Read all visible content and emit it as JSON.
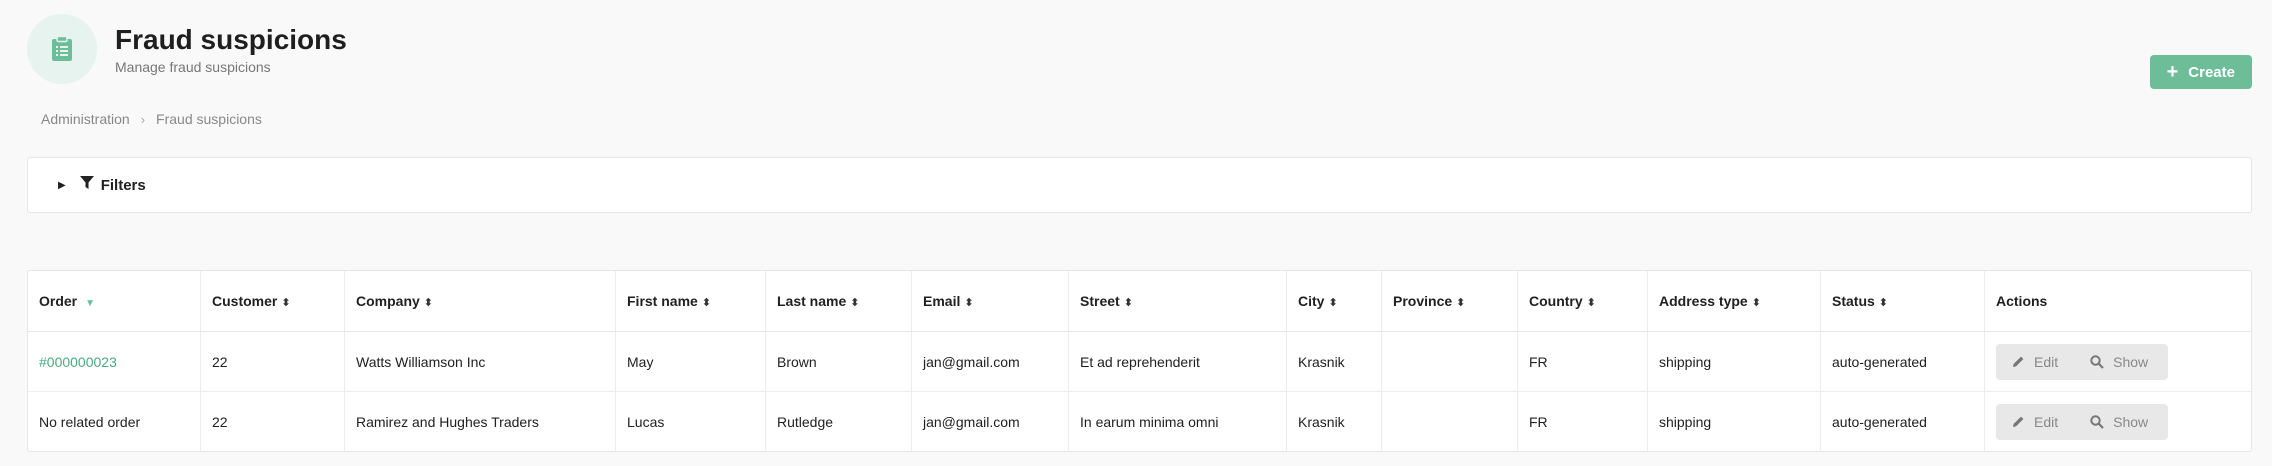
{
  "header": {
    "title": "Fraud suspicions",
    "subtitle": "Manage fraud suspicions",
    "icon": "clipboard-list-icon",
    "accent": "#6cbd98"
  },
  "toolbar": {
    "create_label": "Create"
  },
  "breadcrumb": [
    "Administration",
    "Fraud suspicions"
  ],
  "filters": {
    "label": "Filters"
  },
  "table": {
    "columns": [
      "Order",
      "Customer",
      "Company",
      "First name",
      "Last name",
      "Email",
      "Street",
      "City",
      "Province",
      "Country",
      "Address type",
      "Status",
      "Actions"
    ],
    "rows": [
      {
        "order": "#000000023",
        "customer": "22",
        "company": "Watts Williamson Inc",
        "first_name": "May",
        "last_name": "Brown",
        "email": "jan@gmail.com",
        "street": "Et ad reprehenderit",
        "city": "Krasnik",
        "province": "",
        "country": "FR",
        "address_type": "shipping",
        "status": "auto-generated"
      },
      {
        "order": "No related order",
        "customer": "22",
        "company": "Ramirez and Hughes Traders",
        "first_name": "Lucas",
        "last_name": "Rutledge",
        "email": "jan@gmail.com",
        "street": "In earum minima omni",
        "city": "Krasnik",
        "province": "",
        "country": "FR",
        "address_type": "shipping",
        "status": "auto-generated"
      }
    ],
    "actions": {
      "edit": "Edit",
      "show": "Show"
    }
  }
}
